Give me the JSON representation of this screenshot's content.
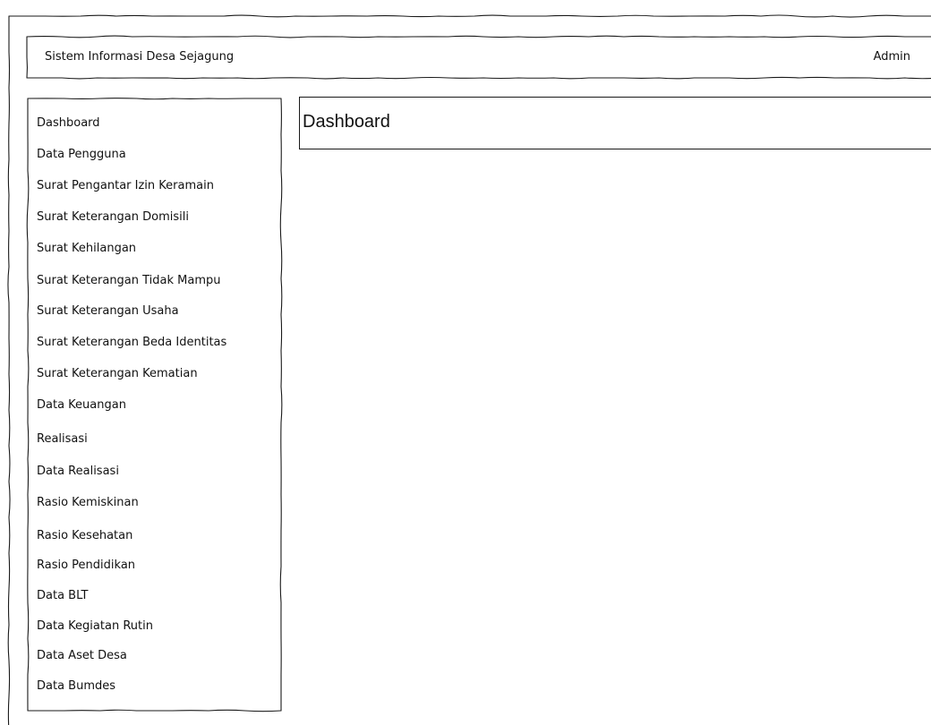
{
  "header": {
    "title": "Sistem Informasi Desa Sejagung",
    "user": "Admin"
  },
  "sidebar": {
    "items": [
      {
        "label": "Dashboard"
      },
      {
        "label": "Data Pengguna"
      },
      {
        "label": "Surat Pengantar Izin Keramain"
      },
      {
        "label": "Surat Keterangan Domisili"
      },
      {
        "label": "Surat Kehilangan"
      },
      {
        "label": "Surat Keterangan Tidak Mampu"
      },
      {
        "label": "Surat Keterangan Usaha"
      },
      {
        "label": "Surat Keterangan Beda Identitas"
      },
      {
        "label": "Surat Keterangan Kematian"
      },
      {
        "label": "Data Keuangan"
      },
      {
        "label": "Realisasi"
      },
      {
        "label": "Data Realisasi"
      },
      {
        "label": "Rasio Kemiskinan"
      },
      {
        "label": "Rasio Kesehatan"
      },
      {
        "label": "Rasio Pendidikan"
      },
      {
        "label": "Data BLT"
      },
      {
        "label": "Data Kegiatan Rutin"
      },
      {
        "label": "Data Aset Desa"
      },
      {
        "label": "Data Bumdes"
      }
    ]
  },
  "main": {
    "title": "Dashboard"
  }
}
